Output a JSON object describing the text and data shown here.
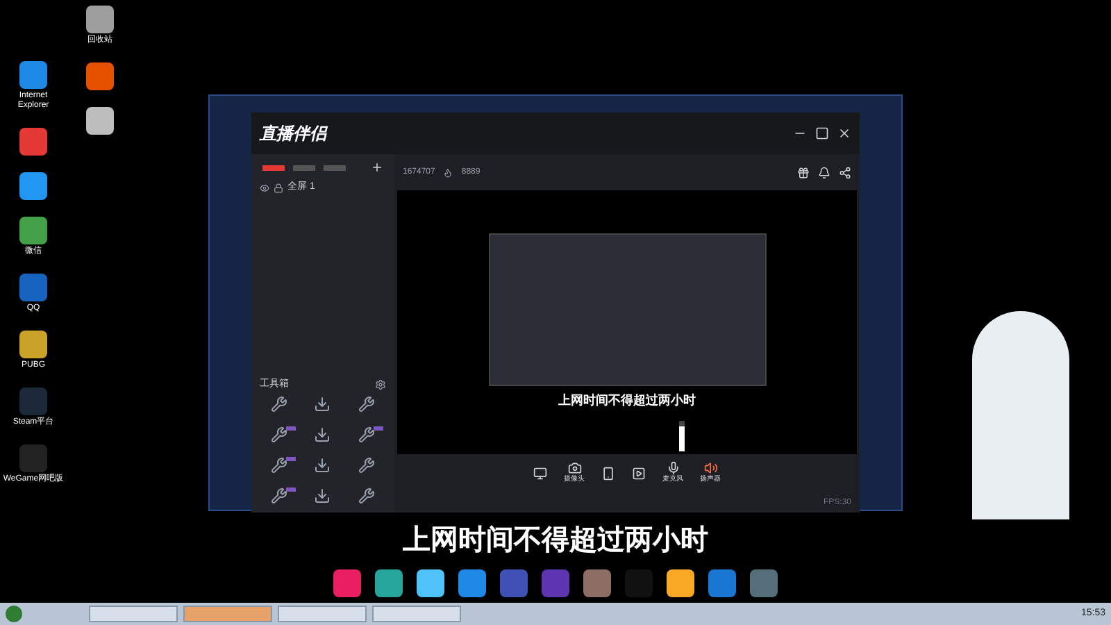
{
  "desktop_icons": [
    {
      "label": "Internet Explorer",
      "color": "#1e88e5"
    },
    {
      "color": "#e53935"
    },
    {
      "color": "#2196f3"
    },
    {
      "label": "微信",
      "color": "#43a047"
    },
    {
      "label": "QQ",
      "color": "#1565c0"
    },
    {
      "label": "PUBG",
      "color": "#c9a227"
    },
    {
      "label": "Steam平台",
      "color": "#1b2838"
    },
    {
      "label": "WeGame网吧版",
      "color": "#222222"
    }
  ],
  "desktop_icons_col2": [
    {
      "label": "回收站",
      "color": "#9e9e9e"
    },
    {
      "color": "#e65100"
    },
    {
      "color": "#bdbdbd"
    }
  ],
  "app": {
    "logo": "直播伴侣",
    "left_tabs": [
      {
        "selected": true
      },
      {
        "selected": false
      },
      {
        "selected": false
      }
    ],
    "scene": "全屏 1",
    "toolbox_title": "工具箱",
    "tools": [
      {
        "badge": false
      },
      {
        "badge": false
      },
      {
        "badge": false
      },
      {
        "badge": true
      },
      {
        "badge": false
      },
      {
        "badge": true
      },
      {
        "badge": true
      },
      {
        "badge": false
      },
      {
        "badge": false
      },
      {
        "badge": true
      },
      {
        "badge": false
      },
      {
        "badge": false
      }
    ],
    "room_id": "1674707",
    "viewers": "8889",
    "subtitle": "上网时间不得超过两小时",
    "controls": [
      {
        "kind": "screen"
      },
      {
        "kind": "camera",
        "label": "摄像头"
      },
      {
        "kind": "phone"
      },
      {
        "kind": "media"
      },
      {
        "kind": "mic",
        "label": "麦克风"
      },
      {
        "kind": "speaker",
        "label": "扬声器"
      }
    ],
    "volume": {
      "level": 0.8
    },
    "status": "FPS:30"
  },
  "subtitle": "上网时间不得超过两小时",
  "dock": [
    {
      "color": "#e91e63"
    },
    {
      "color": "#26a69a"
    },
    {
      "color": "#4fc3f7"
    },
    {
      "color": "#1e88e5"
    },
    {
      "color": "#3f51b5"
    },
    {
      "color": "#5e35b1"
    },
    {
      "color": "#8d6e63"
    },
    {
      "color": "#111111"
    },
    {
      "color": "#f9a825"
    },
    {
      "color": "#1976d2"
    },
    {
      "color": "#546e7a"
    }
  ],
  "taskbar": {
    "clock": "15:53",
    "windows": [
      {
        "selected": false
      },
      {
        "selected": true
      },
      {
        "selected": false
      },
      {
        "selected": false
      }
    ]
  }
}
